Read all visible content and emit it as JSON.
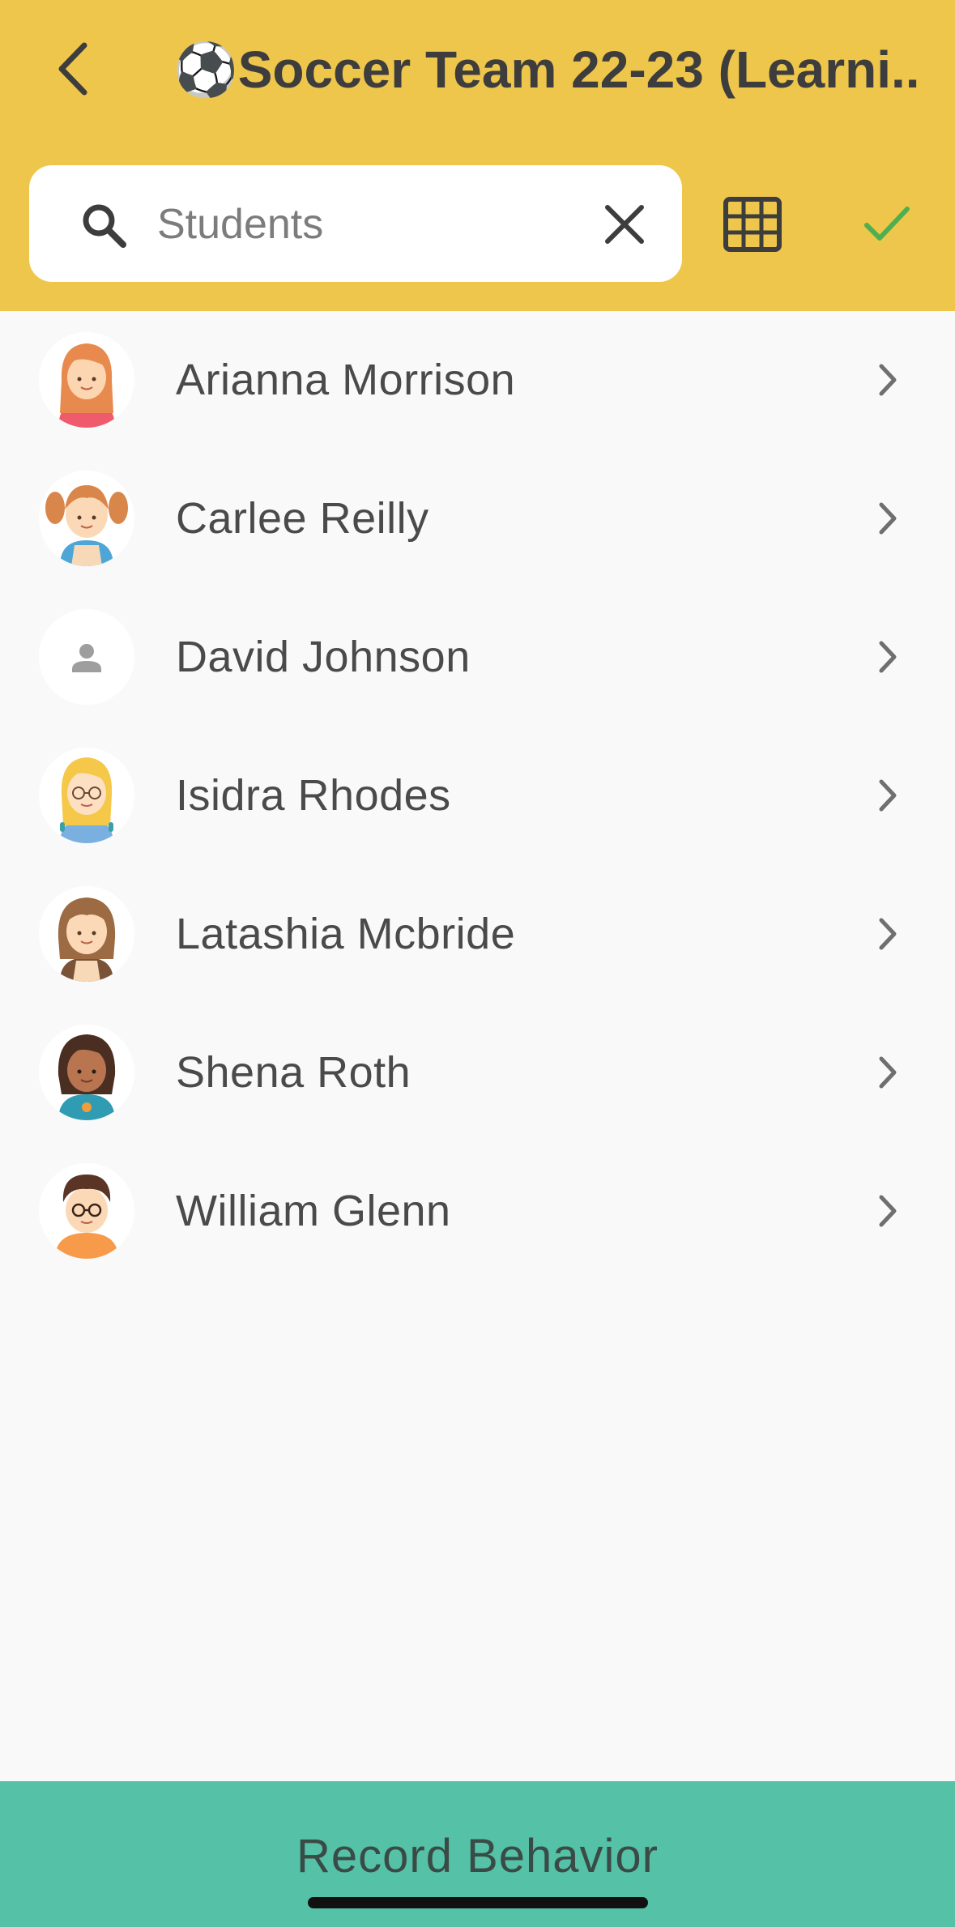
{
  "header": {
    "title": "⚽Soccer Team 22-23 (Learni...",
    "back_icon": "chevron-left-icon",
    "background": "#eec64c"
  },
  "search": {
    "placeholder": "Students",
    "value": "",
    "icon": "search-icon",
    "clear_icon": "close-icon"
  },
  "toolbar": {
    "grid_icon": "grid-icon",
    "check_icon": "check-icon",
    "check_color": "#4caf50"
  },
  "students": [
    {
      "name": "Arianna Morrison",
      "avatar": "girl-red-hair-avatar"
    },
    {
      "name": "Carlee Reilly",
      "avatar": "girl-pigtails-avatar"
    },
    {
      "name": "David Johnson",
      "avatar": "default-person-avatar"
    },
    {
      "name": "Isidra Rhodes",
      "avatar": "girl-blonde-glasses-avatar"
    },
    {
      "name": "Latashia Mcbride",
      "avatar": "girl-brown-hair-avatar"
    },
    {
      "name": "Shena Roth",
      "avatar": "girl-dark-hair-avatar"
    },
    {
      "name": "William Glenn",
      "avatar": "boy-glasses-avatar"
    }
  ],
  "footer": {
    "button_label": "Record Behavior",
    "background": "#55c1a6"
  }
}
